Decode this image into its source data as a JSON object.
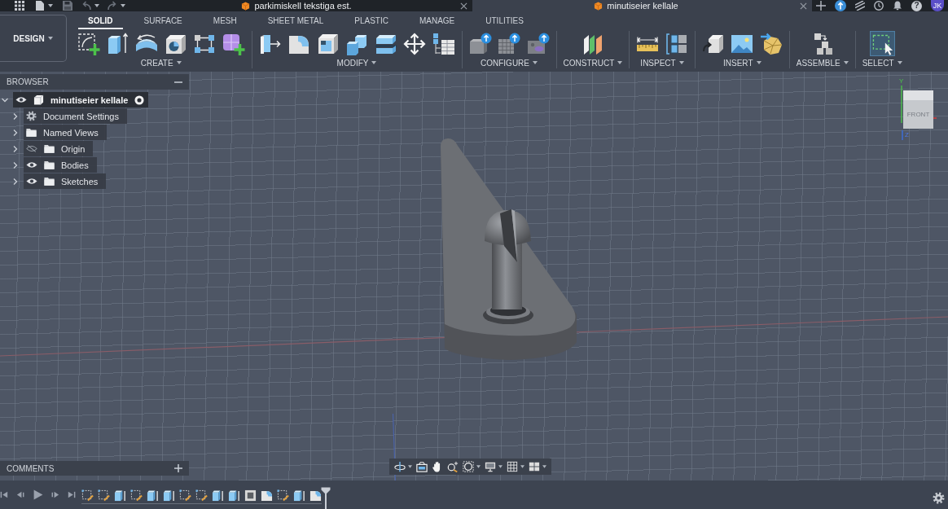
{
  "title_bar": {
    "tabs": [
      {
        "label": "parkimiskell tekstiga est.",
        "selected": false
      },
      {
        "label": "minutiseier kellale",
        "selected": true
      }
    ],
    "help": "?",
    "avatar": "JK"
  },
  "toolbar": {
    "workspace": "DESIGN",
    "tabs": [
      {
        "label": "SOLID",
        "selected": true
      },
      {
        "label": "SURFACE",
        "selected": false
      },
      {
        "label": "MESH",
        "selected": false
      },
      {
        "label": "SHEET METAL",
        "selected": false
      },
      {
        "label": "PLASTIC",
        "selected": false
      },
      {
        "label": "MANAGE",
        "selected": false
      },
      {
        "label": "UTILITIES",
        "selected": false
      }
    ],
    "groups": [
      {
        "label": "CREATE"
      },
      {
        "label": "MODIFY"
      },
      {
        "label": "CONFIGURE"
      },
      {
        "label": "CONSTRUCT"
      },
      {
        "label": "INSPECT"
      },
      {
        "label": "INSERT"
      },
      {
        "label": "ASSEMBLE"
      },
      {
        "label": "SELECT"
      }
    ]
  },
  "browser": {
    "title": "BROWSER",
    "tree": [
      {
        "label": "minutiseier kellale",
        "kind": "component",
        "expanded": true,
        "visible": true,
        "active": true,
        "children": [
          {
            "label": "Document Settings",
            "kind": "settings",
            "expanded": false
          },
          {
            "label": "Named Views",
            "kind": "folder",
            "expanded": false
          },
          {
            "label": "Origin",
            "kind": "folder",
            "expanded": false,
            "visible": false
          },
          {
            "label": "Bodies",
            "kind": "folder",
            "expanded": false,
            "visible": true
          },
          {
            "label": "Sketches",
            "kind": "folder",
            "expanded": false,
            "visible": true
          }
        ]
      }
    ]
  },
  "view_cube": {
    "face": "FRONT",
    "axes": [
      {
        "label": "Y"
      },
      {
        "label": "Z"
      }
    ]
  },
  "comments": {
    "title": "COMMENTS"
  }
}
